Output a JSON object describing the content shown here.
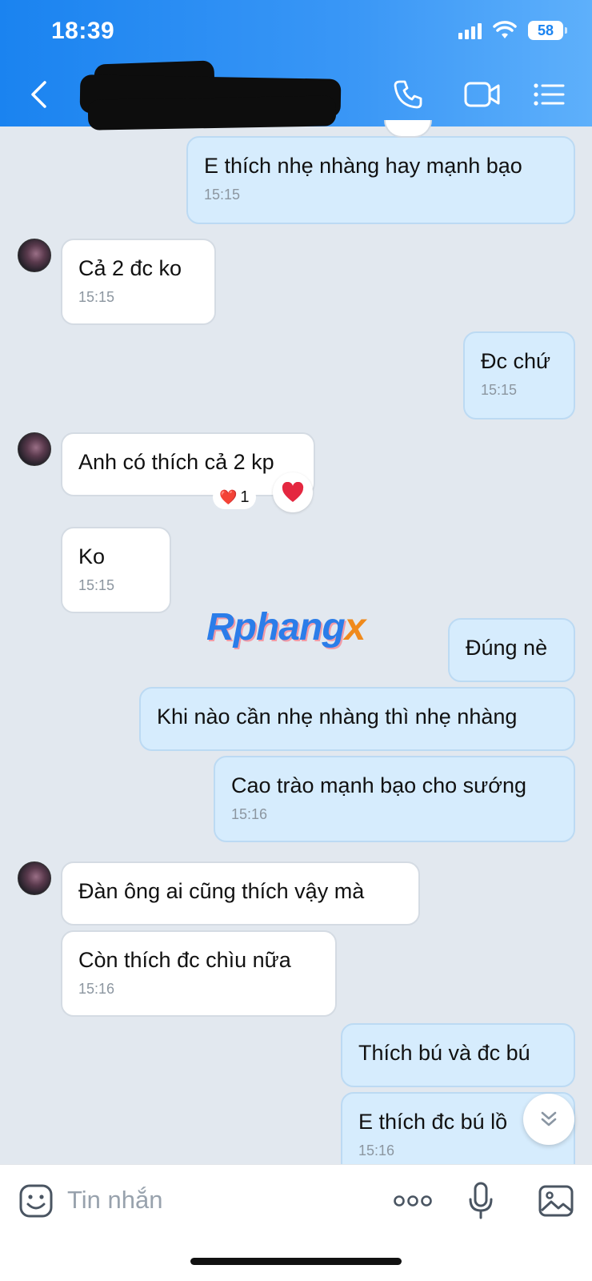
{
  "status_bar": {
    "time": "18:39",
    "battery": "58"
  },
  "header": {
    "icons": [
      "back-icon",
      "phone-icon",
      "video-call-icon",
      "menu-list-icon"
    ]
  },
  "messages": [
    {
      "dir": "out",
      "text": "E thích nhẹ nhàng hay mạnh bạo",
      "time": "15:15"
    },
    {
      "dir": "in",
      "text": "Cả 2 đc ko",
      "time": "15:15"
    },
    {
      "dir": "out",
      "text": "Đc chứ",
      "time": "15:15"
    },
    {
      "dir": "in",
      "text": "Anh có thích cả 2 kp",
      "reaction": {
        "emoji": "❤️",
        "count": "1"
      }
    },
    {
      "dir": "in",
      "text": "Ko",
      "time": "15:15"
    },
    {
      "dir": "out",
      "text": "Đúng nè"
    },
    {
      "dir": "out",
      "text": "Khi nào cần nhẹ nhàng thì nhẹ nhàng"
    },
    {
      "dir": "out",
      "text": "Cao trào mạnh bạo cho sướng",
      "time": "15:16"
    },
    {
      "dir": "in",
      "text": "Đàn ông ai cũng thích vậy mà"
    },
    {
      "dir": "in",
      "text": "Còn thích đc chìu nữa",
      "time": "15:16"
    },
    {
      "dir": "out",
      "text": "Thích bú và đc bú"
    },
    {
      "dir": "out",
      "text": "E thích đc bú lồ",
      "time": "15:16"
    }
  ],
  "watermark": {
    "part1": "Rphang",
    "part2": "x"
  },
  "colors": {
    "header": "#2d8ff3",
    "bubble_out": "#d6ecfd",
    "bubble_in": "#ffffff",
    "background": "#e2e8ef"
  },
  "input": {
    "placeholder": "Tin nhắn",
    "icons": [
      "sticker-icon",
      "more-icon",
      "microphone-icon",
      "image-icon"
    ]
  }
}
